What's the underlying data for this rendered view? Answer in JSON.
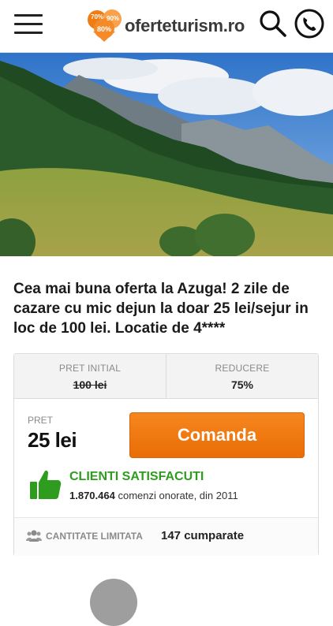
{
  "header": {
    "logo_text": "oferteturism.ro",
    "logo_badges": [
      "70%",
      "90%",
      "80%"
    ]
  },
  "deal": {
    "title": "Cea mai buna oferta la Azuga! 2 zile de cazare cu mic dejun la doar 25 lei/sejur in loc de 100 lei. Locatie de 4****"
  },
  "pricing": {
    "initial_label": "PRET INITIAL",
    "initial_value": "100 lei",
    "discount_label": "REDUCERE",
    "discount_value": "75%",
    "price_label": "PRET",
    "price_value": "25 lei",
    "order_button": "Comanda"
  },
  "satisfaction": {
    "title": "CLIENTI SATISFACUTI",
    "count": "1.870.464",
    "text": "comenzi onorate, din 2011"
  },
  "stock": {
    "label": "CANTITATE LIMITATA",
    "bought": "147 cumparate"
  },
  "colors": {
    "accent": "#f07c14",
    "success": "#2e9d1f"
  },
  "icons": [
    "hamburger-icon",
    "search-icon",
    "phone-icon",
    "thumbs-up-icon",
    "users-icon"
  ]
}
